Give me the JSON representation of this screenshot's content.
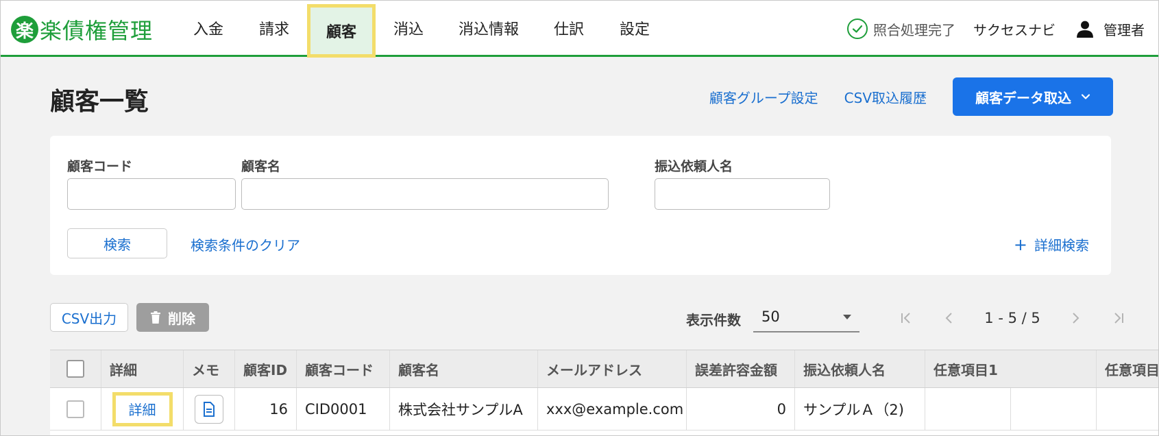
{
  "header": {
    "logo_mark": "楽",
    "logo_text": "楽債権管理",
    "nav": [
      {
        "label": "入金",
        "name": "nav-payment"
      },
      {
        "label": "請求",
        "name": "nav-invoice"
      },
      {
        "label": "顧客",
        "name": "nav-customer",
        "active": true
      },
      {
        "label": "消込",
        "name": "nav-reconcile"
      },
      {
        "label": "消込情報",
        "name": "nav-reconcile-info"
      },
      {
        "label": "仕訳",
        "name": "nav-journal"
      },
      {
        "label": "設定",
        "name": "nav-settings"
      }
    ],
    "status_text": "照合処理完了",
    "navi_label": "サクセスナビ",
    "user_label": "管理者"
  },
  "page": {
    "title": "顧客一覧",
    "group_settings_link": "顧客グループ設定",
    "csv_history_link": "CSV取込履歴",
    "import_button": "顧客データ取込"
  },
  "search": {
    "code_label": "顧客コード",
    "code_value": "",
    "name_label": "顧客名",
    "name_value": "",
    "payer_label": "振込依頼人名",
    "payer_value": "",
    "search_button": "検索",
    "clear_link": "検索条件のクリア",
    "detail_search_link": "詳細検索"
  },
  "toolbar": {
    "csv_button": "CSV出力",
    "delete_button": "削除",
    "per_page_label": "表示件数",
    "per_page_value": "50",
    "range_text": "1 - 5 / 5"
  },
  "table": {
    "columns": [
      "詳細",
      "メモ",
      "顧客ID",
      "顧客コード",
      "顧客名",
      "メールアドレス",
      "誤差許容金額",
      "振込依頼人名",
      "任意項目1",
      "任意項目"
    ],
    "rows": [
      {
        "detail": "詳細",
        "id": "16",
        "code": "CID0001",
        "name": "株式会社サンプルA",
        "email": "xxx@example.com",
        "tolerance": "0",
        "payer": "サンプルＡ（2)",
        "custom1": "",
        "custom2": ""
      }
    ]
  },
  "colors": {
    "brand_green": "#1e9e3a",
    "link_blue": "#1a6fcf",
    "primary_button": "#1a73e8",
    "highlight_yellow": "#f3dd6a"
  }
}
